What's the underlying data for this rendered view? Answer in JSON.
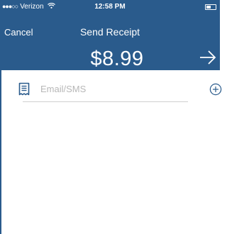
{
  "status_bar": {
    "signal": "●●●○○",
    "carrier": "Verizon",
    "wifi_icon": "wifi-icon",
    "time": "12:58 PM",
    "battery_icon": "battery-icon"
  },
  "nav": {
    "cancel_label": "Cancel",
    "title": "Send Receipt"
  },
  "amount": "$8.99",
  "next_icon": "arrow-right-icon",
  "form": {
    "receipt_icon": "receipt-icon",
    "placeholder": "Email/SMS",
    "value": "",
    "add_icon": "add-circle-icon"
  },
  "colors": {
    "header": "#2a5b8c",
    "text_on_header": "#ffffff",
    "placeholder": "#b7b7b7",
    "icon": "#2a5b8c"
  }
}
